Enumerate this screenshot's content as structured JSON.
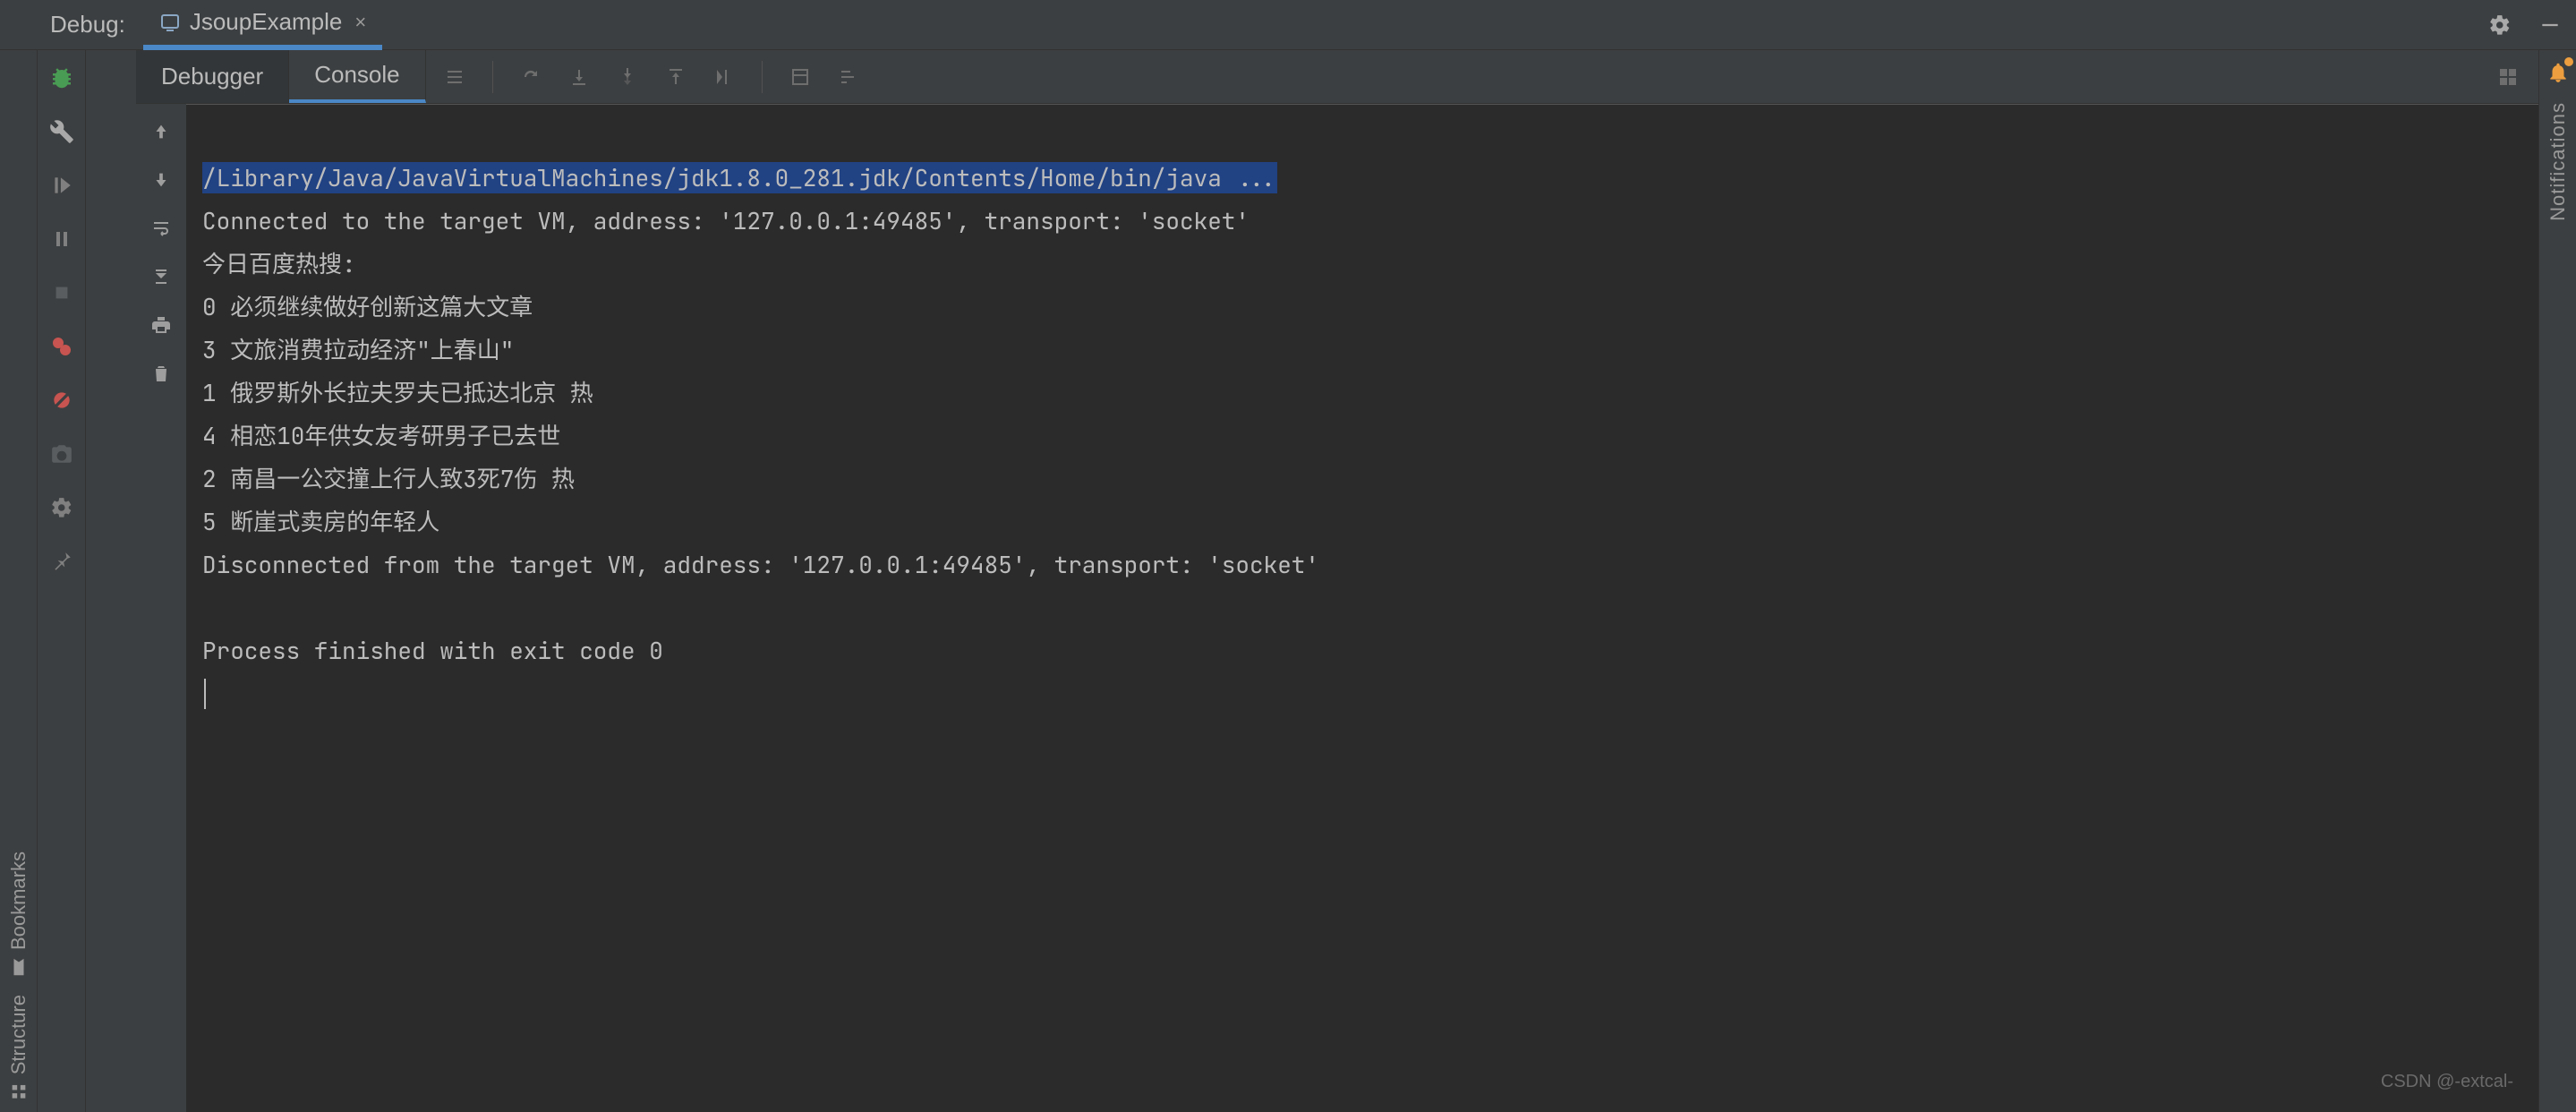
{
  "header": {
    "title": "Debug:",
    "tab_icon": "app-icon",
    "tab_label": "JsoupExample"
  },
  "inner_tabs": {
    "debugger": "Debugger",
    "console": "Console"
  },
  "console_lines": {
    "l0": "/Library/Java/JavaVirtualMachines/jdk1.8.0_281.jdk/Contents/Home/bin/java ...",
    "l1": "Connected to the target VM, address: '127.0.0.1:49485', transport: 'socket'",
    "l2": "今日百度热搜:",
    "l3": "0 必须继续做好创新这篇大文章",
    "l4": "3 文旅消费拉动经济\"上春山\"",
    "l5": "1 俄罗斯外长拉夫罗夫已抵达北京 热",
    "l6": "4 相恋10年供女友考研男子已去世",
    "l7": "2 南昌一公交撞上行人致3死7伤 热",
    "l8": "5 断崖式卖房的年轻人",
    "l9": "Disconnected from the target VM, address: '127.0.0.1:49485', transport: 'socket'",
    "l10": "",
    "l11": "Process finished with exit code 0"
  },
  "right_rail": {
    "label": "Notifications"
  },
  "left_docks": {
    "bookmarks": "Bookmarks",
    "structure": "Structure"
  },
  "watermark": "CSDN @-extcal-"
}
